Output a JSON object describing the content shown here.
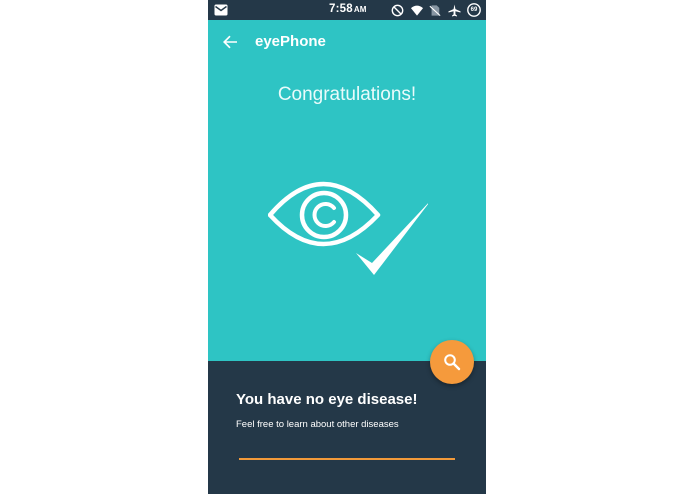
{
  "status_bar": {
    "time": "7:58",
    "ampm": "AM",
    "battery_level": "69",
    "left_icon": "mail-icon",
    "right_icons": [
      "do-not-disturb-icon",
      "wifi-icon",
      "no-sim-icon",
      "airplane-icon",
      "battery-icon"
    ]
  },
  "app_bar": {
    "title": "eyePhone",
    "back_icon": "arrow-back-icon"
  },
  "main": {
    "heading": "Congratulations!",
    "hero_icon": "eye-check-icon",
    "background_color": "#2ec4c4"
  },
  "result": {
    "title": "You have no eye disease!",
    "subtitle": "Feel free to learn about other diseases",
    "panel_color": "#243848",
    "accent_color": "#f29a3a"
  },
  "fab": {
    "icon": "search-icon",
    "color": "#f59a3c"
  }
}
